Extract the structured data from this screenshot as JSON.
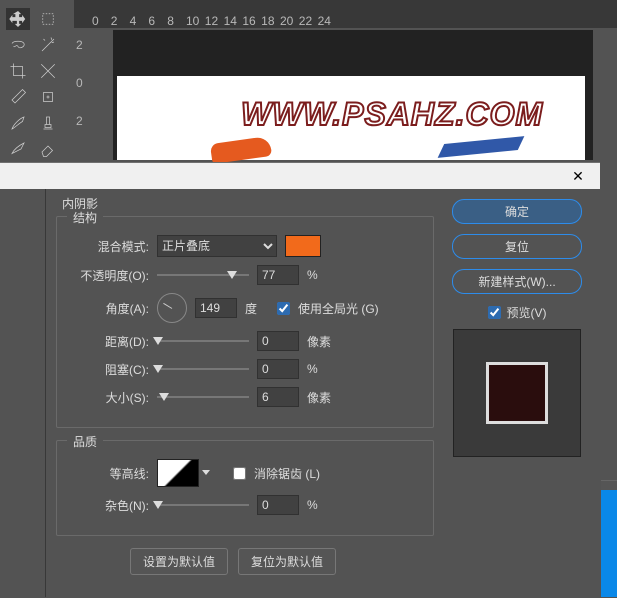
{
  "ruler_h": [
    "0",
    "2",
    "4",
    "6",
    "8",
    "10",
    "12",
    "14",
    "16",
    "18",
    "20",
    "22",
    "24"
  ],
  "ruler_v": [
    "2",
    "0",
    "2"
  ],
  "canvas": {
    "watermark": "WWW.PSAHZ.COM"
  },
  "dialog": {
    "close": "✕",
    "title": "内阴影",
    "structure_legend": "结构",
    "labels": {
      "blend_mode": "混合模式:",
      "opacity": "不透明度(O):",
      "angle": "角度(A):",
      "distance": "距离(D):",
      "spread": "阻塞(C):",
      "size": "大小(S):",
      "contour": "等高线:",
      "noise": "杂色(N):"
    },
    "blend_mode_value": "正片叠底",
    "swatch_color": "#f26a1b",
    "opacity_value": "77",
    "percent": "%",
    "angle_value": "149",
    "degree": "度",
    "use_global_light": "使用全局光 (G)",
    "distance_value": "0",
    "px": "像素",
    "spread_value": "0",
    "size_value": "6",
    "quality_legend": "品质",
    "anti_alias": "消除锯齿 (L)",
    "noise_value": "0",
    "btn_set_default": "设置为默认值",
    "btn_reset_default": "复位为默认值"
  },
  "right": {
    "ok": "确定",
    "reset": "复位",
    "new_style": "新建样式(W)...",
    "preview": "预览(V)"
  }
}
